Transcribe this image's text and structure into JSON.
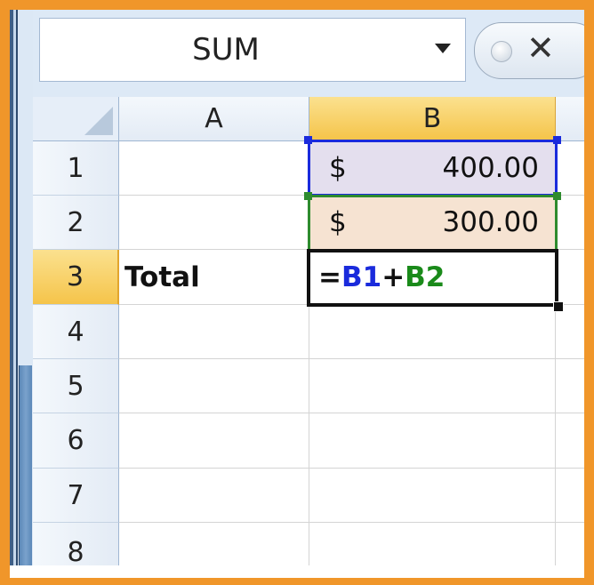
{
  "namebox": {
    "value": "SUM"
  },
  "controls": {
    "close_glyph": "✕"
  },
  "columns": [
    "A",
    "B"
  ],
  "rows": [
    "1",
    "2",
    "3",
    "4",
    "5",
    "6",
    "7",
    "8"
  ],
  "selected": {
    "column": "B",
    "row": "3"
  },
  "cells": {
    "A3": "Total",
    "B1": {
      "currency": "$",
      "amount": "400.00"
    },
    "B2": {
      "currency": "$",
      "amount": "300.00"
    },
    "B3": {
      "eq": "=",
      "ref1": "B1",
      "plus": "+",
      "ref2": "B2"
    }
  },
  "colors": {
    "frame": "#f0962a",
    "selected_header": "#f5c44a",
    "ref_b1": "#1a2bdc",
    "ref_b2": "#1a8a1a",
    "cell_b1_fill": "#e4dfee",
    "cell_b2_fill": "#f6e3d2"
  }
}
